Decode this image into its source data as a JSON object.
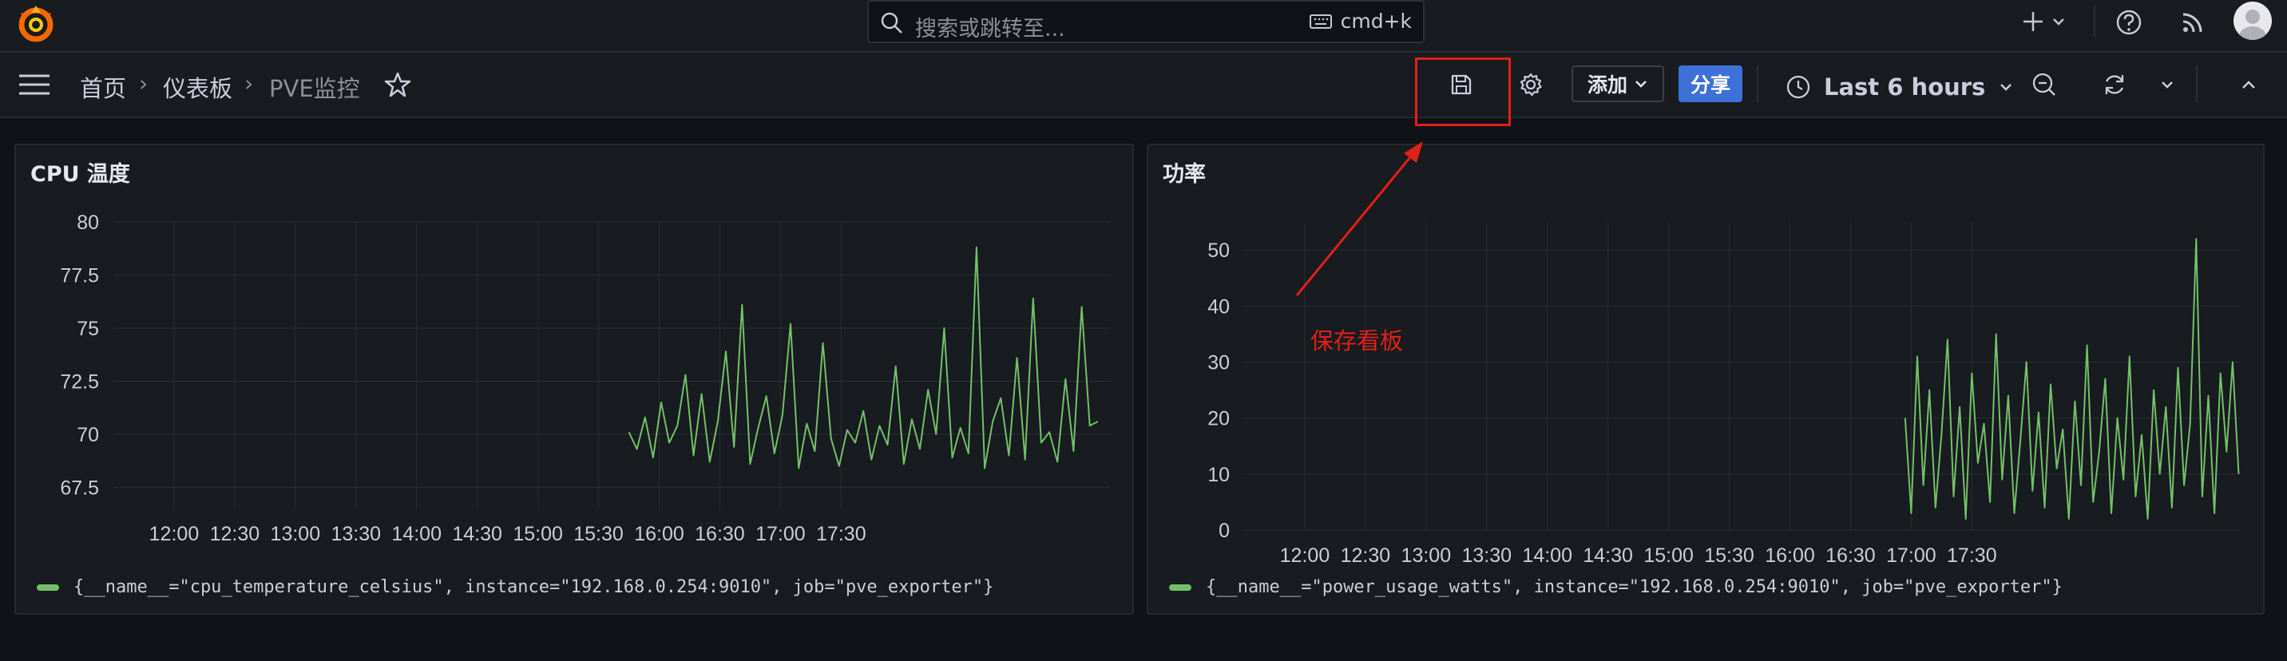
{
  "search": {
    "placeholder": "搜索或跳转至...",
    "shortcut": "cmd+k"
  },
  "breadcrumb": {
    "home": "首页",
    "dashboards": "仪表板",
    "current": "PVE监控"
  },
  "toolbar": {
    "add_label": "添加",
    "share_label": "分享",
    "time_range": "Last 6 hours"
  },
  "annotation": {
    "text": "保存看板"
  },
  "colors": {
    "series": "#73bf69",
    "highlight": "#e0201a",
    "primary": "#3d71d9"
  },
  "icons": [
    "grafana-logo-icon",
    "search-icon",
    "keyboard-icon",
    "plus-icon",
    "help-icon",
    "rss-icon",
    "avatar",
    "menu-icon",
    "star-icon",
    "save-icon",
    "gear-icon",
    "clock-icon",
    "zoom-out-icon",
    "refresh-icon",
    "chevron-up-icon"
  ],
  "panels": [
    {
      "title": "CPU 温度",
      "legend": "{__name__=\"cpu_temperature_celsius\", instance=\"192.168.0.254:9010\", job=\"pve_exporter\"}"
    },
    {
      "title": "功率",
      "legend": "{__name__=\"power_usage_watts\", instance=\"192.168.0.254:9010\", job=\"pve_exporter\"}"
    }
  ],
  "chart_data": [
    {
      "type": "line",
      "title": "CPU 温度",
      "x_ticks": [
        "12:00",
        "12:30",
        "13:00",
        "13:30",
        "14:00",
        "14:30",
        "15:00",
        "15:30",
        "16:00",
        "16:30",
        "17:00",
        "17:30"
      ],
      "y_ticks": [
        67.5,
        70,
        72.5,
        75,
        77.5,
        80
      ],
      "ylim": [
        66.5,
        80
      ],
      "xlim_minutes": [
        -30,
        463
      ],
      "grid": true,
      "legend_placement": "bottom-left",
      "series": [
        {
          "name": "{__name__=\"cpu_temperature_celsius\", instance=\"192.168.0.254:9010\", job=\"pve_exporter\"}",
          "x_minutes": [
            225,
            229,
            233,
            237,
            241,
            245,
            249,
            253,
            257,
            261,
            265,
            269,
            273,
            277,
            281,
            285,
            289,
            293,
            297,
            301,
            305,
            309,
            313,
            317,
            321,
            325,
            329,
            333,
            337,
            341,
            345,
            349,
            353,
            357,
            361,
            365,
            369,
            373,
            377,
            381,
            385,
            389,
            393,
            397,
            401,
            405,
            409,
            413,
            417,
            421,
            425,
            429,
            433,
            437,
            441,
            445,
            449,
            453,
            457
          ],
          "values": [
            70.1,
            69.3,
            70.8,
            68.9,
            71.5,
            69.6,
            70.4,
            72.8,
            69.0,
            71.9,
            68.7,
            70.6,
            73.9,
            69.4,
            76.1,
            68.6,
            70.3,
            71.8,
            69.1,
            70.9,
            75.2,
            68.4,
            70.5,
            69.2,
            74.3,
            69.8,
            68.5,
            70.2,
            69.6,
            71.1,
            68.8,
            70.4,
            69.5,
            73.2,
            68.6,
            70.7,
            69.3,
            72.1,
            70.0,
            75.0,
            68.9,
            70.3,
            69.1,
            78.8,
            68.4,
            70.6,
            71.7,
            69.0,
            73.6,
            68.8,
            76.4,
            69.6,
            70.1,
            68.7,
            72.6,
            69.2,
            76.0,
            70.4,
            70.6
          ]
        }
      ]
    },
    {
      "type": "line",
      "title": "功率",
      "x_ticks": [
        "12:00",
        "12:30",
        "13:00",
        "13:30",
        "14:00",
        "14:30",
        "15:00",
        "15:30",
        "16:00",
        "16:30",
        "17:00",
        "17:30"
      ],
      "y_ticks": [
        0,
        10,
        20,
        30,
        40,
        50
      ],
      "ylim": [
        0,
        55
      ],
      "xlim_minutes": [
        -30,
        463
      ],
      "grid": true,
      "legend_placement": "bottom-left",
      "series": [
        {
          "name": "{__name__=\"power_usage_watts\", instance=\"192.168.0.254:9010\", job=\"pve_exporter\"}",
          "x_minutes": [
            297,
            300,
            303,
            306,
            309,
            312,
            315,
            318,
            321,
            324,
            327,
            330,
            333,
            336,
            339,
            342,
            345,
            348,
            351,
            354,
            357,
            360,
            363,
            366,
            369,
            372,
            375,
            378,
            381,
            384,
            387,
            390,
            393,
            396,
            399,
            402,
            405,
            408,
            411,
            414,
            417,
            420,
            423,
            426,
            429,
            432,
            435,
            438,
            441,
            444,
            447,
            450,
            453,
            456,
            459,
            462
          ],
          "values": [
            20,
            3,
            31,
            8,
            25,
            4,
            17,
            34,
            6,
            22,
            2,
            28,
            12,
            19,
            5,
            35,
            9,
            24,
            3,
            16,
            30,
            7,
            21,
            4,
            26,
            11,
            18,
            2,
            23,
            8,
            33,
            5,
            14,
            27,
            3,
            20,
            9,
            31,
            6,
            17,
            2,
            25,
            10,
            22,
            4,
            29,
            8,
            19,
            52,
            6,
            24,
            3,
            28,
            14,
            30,
            10
          ]
        }
      ]
    }
  ]
}
